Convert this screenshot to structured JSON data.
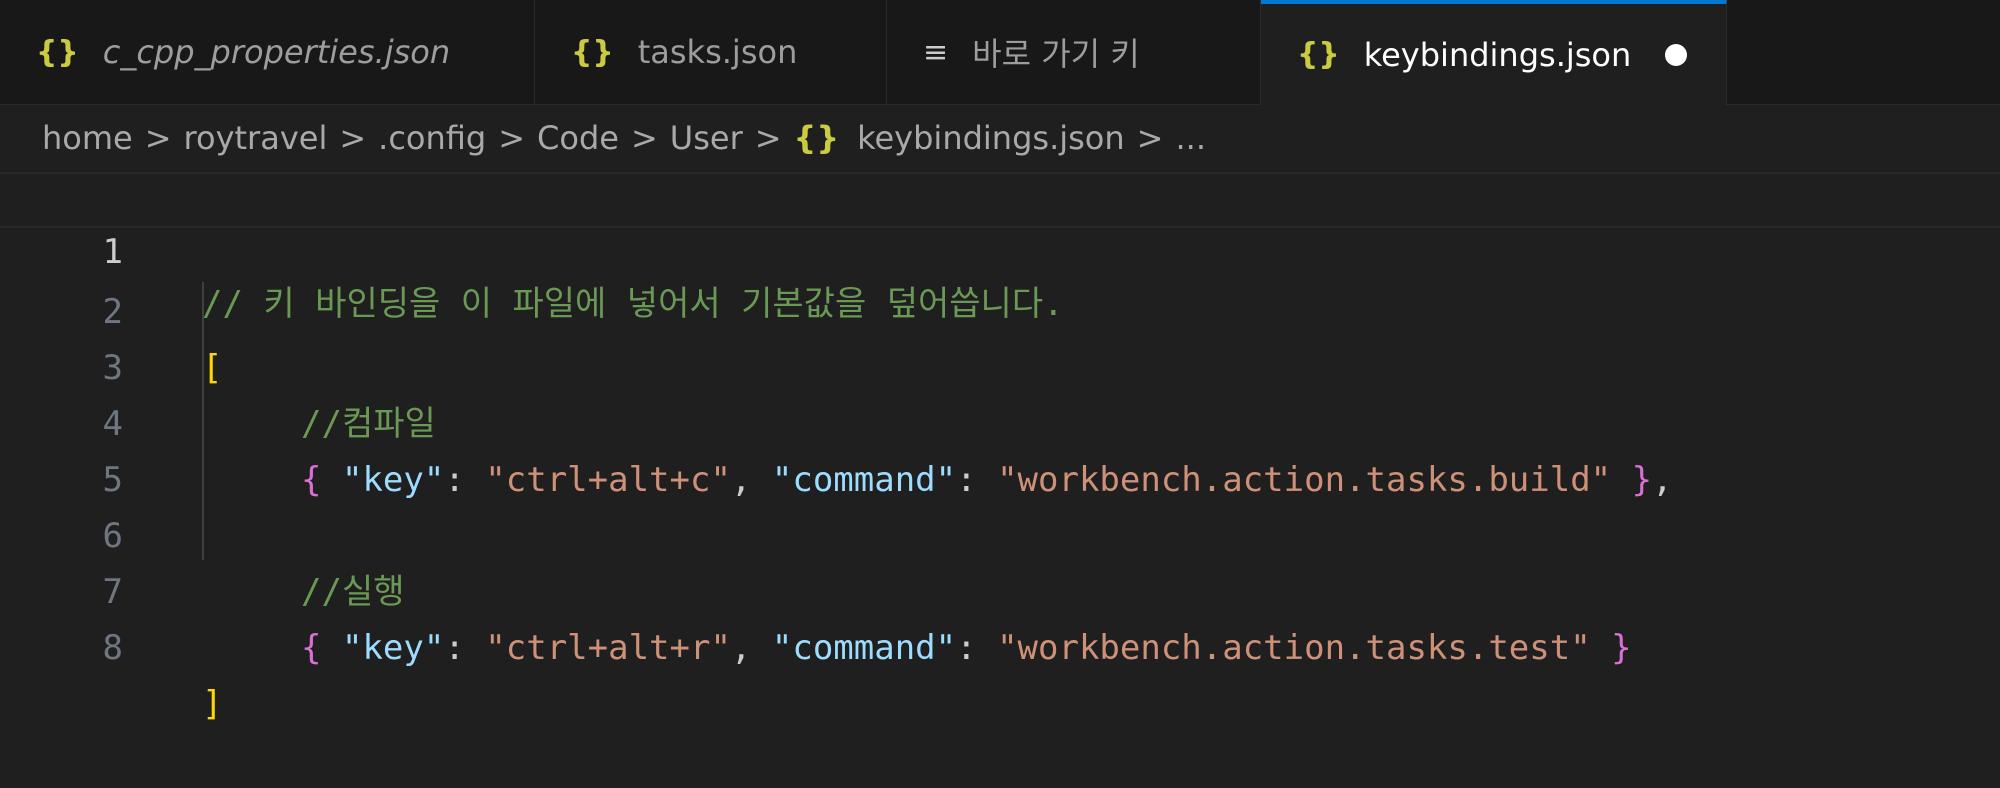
{
  "tabs": [
    {
      "icon": "{}",
      "label": "c_cpp_properties.json",
      "italic": true,
      "active": false
    },
    {
      "icon": "{}",
      "label": "tasks.json",
      "italic": false,
      "active": false
    },
    {
      "icon": "≡",
      "label": "바로 가기 키",
      "italic": false,
      "active": false
    },
    {
      "icon": "{}",
      "label": "keybindings.json",
      "italic": false,
      "active": true,
      "modified": true
    }
  ],
  "breadcrumb": {
    "items": [
      "home",
      "roytravel",
      ".config",
      "Code",
      "User"
    ],
    "file_icon": "{}",
    "file": "keybindings.json",
    "more": "...",
    "separator": ">"
  },
  "editor": {
    "line_numbers": [
      "1",
      "2",
      "3",
      "4",
      "5",
      "6",
      "7",
      "8"
    ],
    "comment_header": "// 키 바인딩을 이 파일에 넣어서 기본값을 덮어씁니다.",
    "open_bracket": "[",
    "close_bracket": "]",
    "comment_compile": "//컴파일",
    "comment_run": "//실행",
    "entry1": {
      "open": "{",
      "key_k": "\"key\"",
      "colon": ": ",
      "key_v": "\"ctrl+alt+c\"",
      "comma": ", ",
      "cmd_k": "\"command\"",
      "cmd_v": "\"workbench.action.tasks.build\"",
      "close": " }",
      "trail": ","
    },
    "entry2": {
      "open": "{",
      "key_k": "\"key\"",
      "colon": ": ",
      "key_v": "\"ctrl+alt+r\"",
      "comma": ", ",
      "cmd_k": "\"command\"",
      "cmd_v": "\"workbench.action.tasks.test\"",
      "close": " }",
      "trail": ""
    }
  },
  "colors": {
    "accent": "#0078d4",
    "json_icon": "#cbcb41",
    "comment": "#6a9955",
    "string": "#ce9178",
    "property": "#9cdcfe"
  }
}
